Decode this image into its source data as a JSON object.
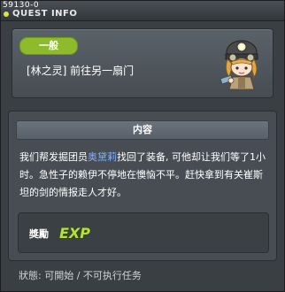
{
  "window": {
    "quest_id": "59130-0",
    "title": "QUEST INFO"
  },
  "quest": {
    "category": "一般",
    "name": "[林之灵] 前往另一扇门"
  },
  "content": {
    "header": "内容",
    "text_before": "我们帮发掘团员",
    "text_highlight": "奥黛莉",
    "text_after": "找回了装备, 可他却让我们等了1小时。急性子的赖伊不停地在懊恼不平。赶快拿到有关崔斯坦的剑的情报走人才好。"
  },
  "reward": {
    "label": "獎勵",
    "icon": "exp-icon",
    "icon_text": "EXP"
  },
  "status": {
    "text": "狀態: 可開始 / 不可执行任务"
  },
  "colors": {
    "category_bg": "#8dbb2c",
    "highlight": "#7fb1ff",
    "exp_fill": "#b7e03a"
  }
}
